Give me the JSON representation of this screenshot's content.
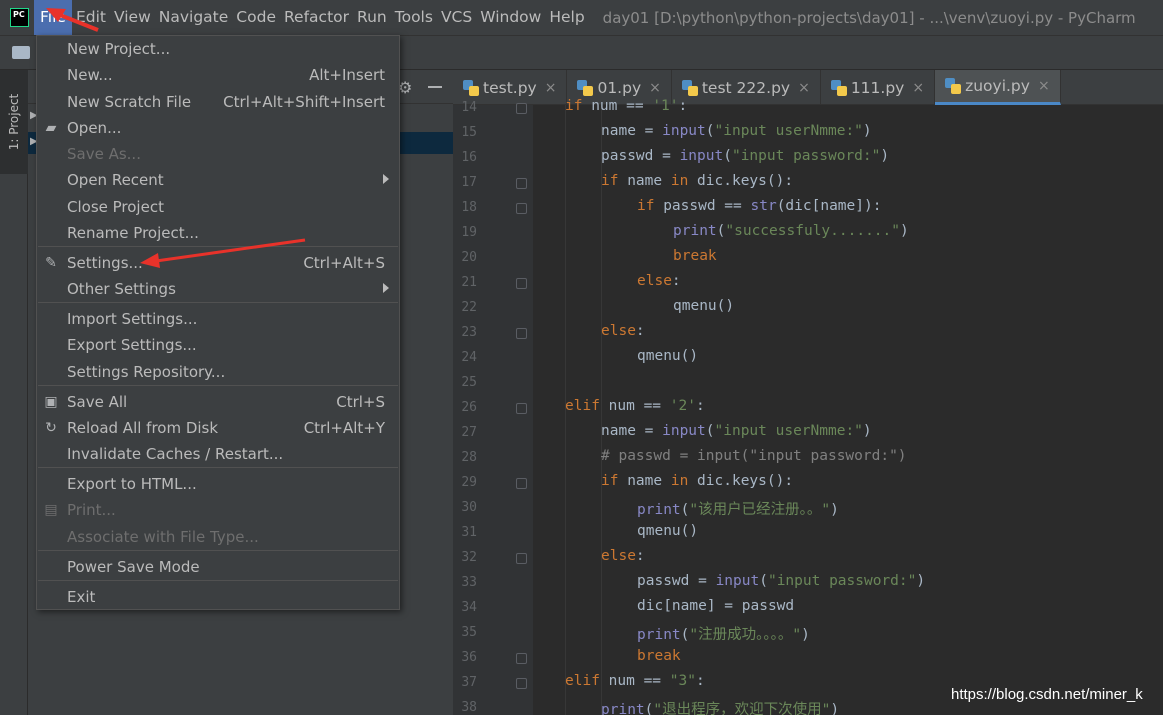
{
  "menubar": {
    "app_icon_text": "PC",
    "items": [
      "File",
      "Edit",
      "View",
      "Navigate",
      "Code",
      "Refactor",
      "Run",
      "Tools",
      "VCS",
      "Window",
      "Help"
    ],
    "window_title": "day01 [D:\\python\\python-projects\\day01] - ...\\venv\\zuoyi.py - PyCharm"
  },
  "sidebar": {
    "project_tab_label": "1: Project"
  },
  "tabs": [
    {
      "label": "test.py",
      "active": false
    },
    {
      "label": "01.py",
      "active": false
    },
    {
      "label": "test 222.py",
      "active": false
    },
    {
      "label": "111.py",
      "active": false
    },
    {
      "label": "zuoyi.py",
      "active": true
    }
  ],
  "file_menu": {
    "items": [
      {
        "label": "New Project...",
        "shortcut": "",
        "icon": "",
        "submenu": false,
        "disabled": false
      },
      {
        "label": "New...",
        "shortcut": "Alt+Insert",
        "icon": "",
        "submenu": false,
        "disabled": false
      },
      {
        "label": "New Scratch File",
        "shortcut": "Ctrl+Alt+Shift+Insert",
        "icon": "",
        "submenu": false,
        "disabled": false
      },
      {
        "label": "Open...",
        "shortcut": "",
        "icon": "folder-open-icon",
        "submenu": false,
        "disabled": false
      },
      {
        "label": "Save As...",
        "shortcut": "",
        "icon": "",
        "submenu": false,
        "disabled": true
      },
      {
        "label": "Open Recent",
        "shortcut": "",
        "icon": "",
        "submenu": true,
        "disabled": false
      },
      {
        "label": "Close Project",
        "shortcut": "",
        "icon": "",
        "submenu": false,
        "disabled": false
      },
      {
        "label": "Rename Project...",
        "shortcut": "",
        "icon": "",
        "submenu": false,
        "disabled": false
      },
      {
        "label": "Settings...",
        "shortcut": "Ctrl+Alt+S",
        "icon": "wrench-icon",
        "submenu": false,
        "disabled": false
      },
      {
        "label": "Other Settings",
        "shortcut": "",
        "icon": "",
        "submenu": true,
        "disabled": false
      },
      {
        "label": "Import Settings...",
        "shortcut": "",
        "icon": "",
        "submenu": false,
        "disabled": false
      },
      {
        "label": "Export Settings...",
        "shortcut": "",
        "icon": "",
        "submenu": false,
        "disabled": false
      },
      {
        "label": "Settings Repository...",
        "shortcut": "",
        "icon": "",
        "submenu": false,
        "disabled": false
      },
      {
        "label": "Save All",
        "shortcut": "Ctrl+S",
        "icon": "save-icon",
        "submenu": false,
        "disabled": false
      },
      {
        "label": "Reload All from Disk",
        "shortcut": "Ctrl+Alt+Y",
        "icon": "reload-icon",
        "submenu": false,
        "disabled": false
      },
      {
        "label": "Invalidate Caches / Restart...",
        "shortcut": "",
        "icon": "",
        "submenu": false,
        "disabled": false
      },
      {
        "label": "Export to HTML...",
        "shortcut": "",
        "icon": "",
        "submenu": false,
        "disabled": false
      },
      {
        "label": "Print...",
        "shortcut": "",
        "icon": "printer-icon",
        "submenu": false,
        "disabled": true
      },
      {
        "label": "Associate with File Type...",
        "shortcut": "",
        "icon": "",
        "submenu": false,
        "disabled": true
      },
      {
        "label": "Power Save Mode",
        "shortcut": "",
        "icon": "",
        "submenu": false,
        "disabled": false
      },
      {
        "label": "Exit",
        "shortcut": "",
        "icon": "",
        "submenu": false,
        "disabled": false
      }
    ]
  },
  "editor": {
    "line_numbers": [
      "14",
      "15",
      "16",
      "17",
      "18",
      "19",
      "20",
      "21",
      "22",
      "23",
      "24",
      "25",
      "26",
      "27",
      "28",
      "29",
      "30",
      "31",
      "32",
      "33",
      "34",
      "35",
      "36",
      "37",
      "38"
    ],
    "lines": [
      "if num == '1':",
      "name = input(\"input userNmme:\")",
      "passwd = input(\"input password:\")",
      "if name in dic.keys():",
      "if passwd == str(dic[name]):",
      "print(\"successfuly.......\")",
      "break",
      "else:",
      "qmenu()",
      "else:",
      "qmenu()",
      "",
      "elif num == '2':",
      "name = input(\"input userNmme:\")",
      "# passwd = input(\"input password:\")",
      "if name in dic.keys():",
      "print(\"该用户已经注册。。\")",
      "qmenu()",
      "else:",
      "passwd = input(\"input password:\")",
      "dic[name] = passwd",
      "print(\"注册成功。。。。\")",
      "break",
      "elif num == \"3\":",
      "print(\"退出程序，欢迎下次使用\")"
    ]
  },
  "watermark": "https://blog.csdn.net/miner_k",
  "colors": {
    "menu_active": "#4b6eaf",
    "annotation_arrow": "#e8322a",
    "keyword": "#cc7832",
    "string": "#6a8759"
  }
}
